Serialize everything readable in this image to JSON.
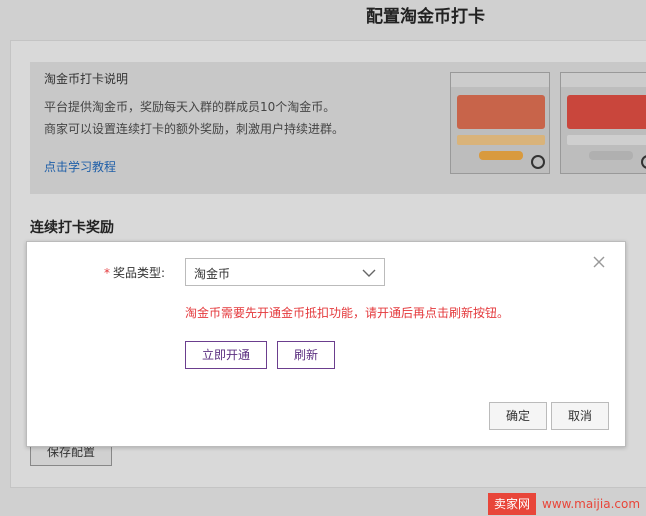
{
  "page": {
    "title": "配置淘金币打卡"
  },
  "intro": {
    "title": "淘金币打卡说明",
    "line1": "平台提供淘金币，奖励每天入群的群成员10个淘金币。",
    "line2": "商家可以设置连续打卡的额外奖励，刺激用户持续进群。",
    "link": "点击学习教程"
  },
  "section": {
    "title": "连续打卡奖励"
  },
  "save_button": "保存配置",
  "modal": {
    "required_mark": "*",
    "field_label": "奖品类型:",
    "select_value": "淘金币",
    "warning": "淘金币需要先开通金币抵扣功能，请开通后再点击刷新按钮。",
    "open_button": "立即开通",
    "refresh_button": "刷新",
    "confirm_button": "确定",
    "cancel_button": "取消"
  },
  "watermark": {
    "brand": "卖家网",
    "url": "www.maijia.com"
  },
  "colors": {
    "accent_purple": "#5b2f80",
    "warning_red": "#e4393c",
    "link_blue": "#1f5fa8"
  },
  "icons": {
    "close": "close-icon",
    "dropdown": "chevron-down-icon",
    "zoom": "magnifier-icon"
  }
}
